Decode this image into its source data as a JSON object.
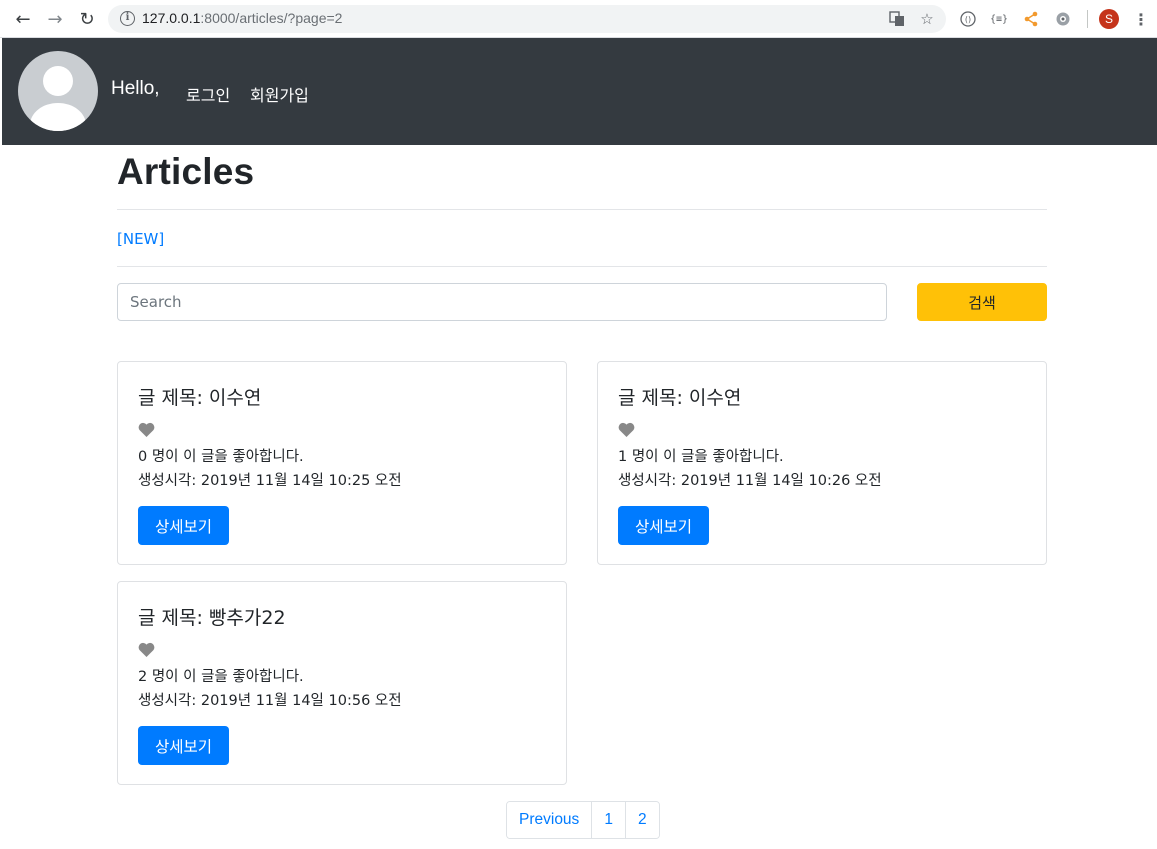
{
  "browser": {
    "url_host": "127.0.0.1",
    "url_path": ":8000/articles/?page=2",
    "profile_initial": "S"
  },
  "header": {
    "greeting": "Hello,",
    "nav": [
      {
        "label": "로그인"
      },
      {
        "label": "회원가입"
      }
    ]
  },
  "main": {
    "title": "Articles",
    "new_link": "[NEW]",
    "search": {
      "placeholder": "Search",
      "button_label": "검색"
    },
    "articles": [
      {
        "title": "글 제목: 이수연",
        "likes": "0 명이 이 글을 좋아합니다.",
        "created": "생성시각: 2019년 11월 14일 10:25 오전",
        "button": "상세보기"
      },
      {
        "title": "글 제목: 이수연",
        "likes": "1 명이 이 글을 좋아합니다.",
        "created": "생성시각: 2019년 11월 14일 10:26 오전",
        "button": "상세보기"
      },
      {
        "title": "글 제목: 빵추가22",
        "likes": "2 명이 이 글을 좋아합니다.",
        "created": "생성시각: 2019년 11월 14일 10:56 오전",
        "button": "상세보기"
      }
    ],
    "pagination": [
      "Previous",
      "1",
      "2"
    ]
  },
  "colors": {
    "header_bg": "#343a40",
    "primary": "#007bff",
    "warning": "#ffc107",
    "heart": "#888888"
  }
}
